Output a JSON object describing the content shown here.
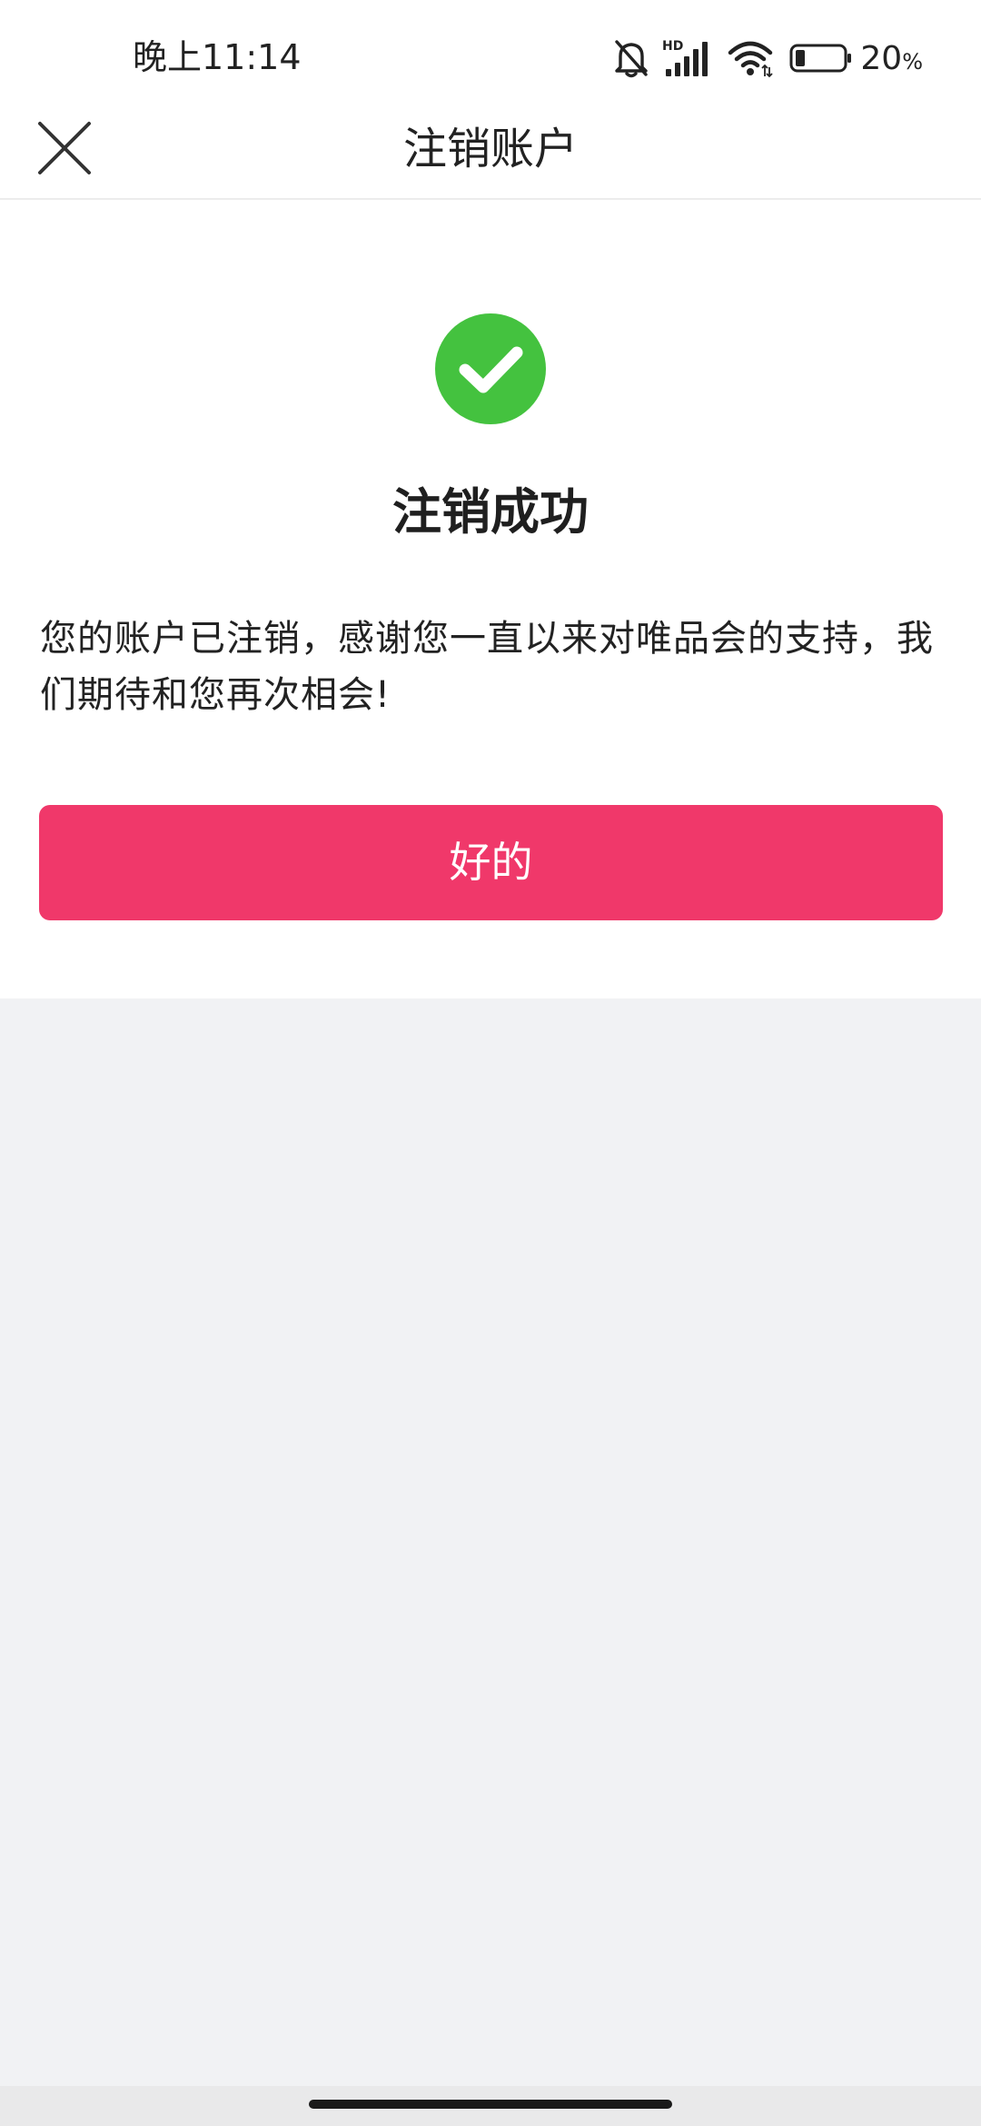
{
  "status_bar": {
    "time": "晚上11:14",
    "battery_level": "20",
    "battery_unit": "%",
    "battery_fill_fraction": 0.2,
    "network_label": "HD",
    "icons": [
      "bell-off-icon",
      "signal-icon",
      "wifi-icon",
      "battery-icon"
    ]
  },
  "nav": {
    "title": "注销账户",
    "close_icon": "close-icon"
  },
  "result": {
    "icon": "check-circle-icon",
    "title": "注销成功",
    "message": "您的账户已注销，感谢您一直以来对唯品会的支持，我们期待和您再次相会!",
    "button_label": "好的"
  },
  "colors": {
    "success_green": "#44c23f",
    "button_pink": "#f0386a",
    "page_background": "#f1f2f4"
  }
}
